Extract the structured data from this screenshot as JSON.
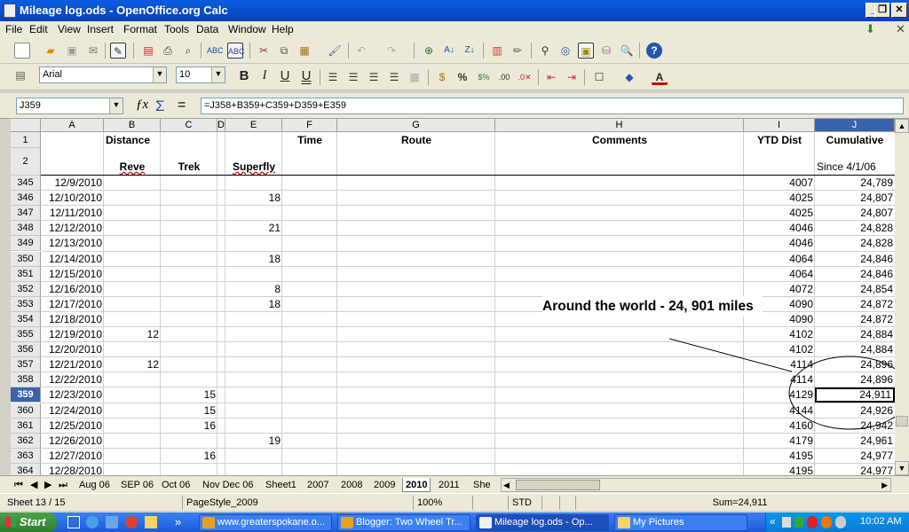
{
  "window": {
    "title": "Mileage log.ods - OpenOffice.org Calc"
  },
  "menu": [
    "File",
    "Edit",
    "View",
    "Insert",
    "Format",
    "Tools",
    "Data",
    "Window",
    "Help"
  ],
  "format_bar": {
    "font_name": "Arial",
    "font_size": "10",
    "bold": "B",
    "italic": "I",
    "underline": "U",
    "double_underline": "U"
  },
  "formula_bar": {
    "name_box": "J359",
    "formula": "=J358+B359+C359+D359+E359"
  },
  "columns": [
    "A",
    "B",
    "C",
    "D",
    "E",
    "F",
    "G",
    "H",
    "I",
    "J"
  ],
  "header_rows": {
    "row1": {
      "num": "1",
      "B": "Distance",
      "F": "Time",
      "G": "Route",
      "H": "Comments",
      "I": "YTD Dist",
      "J": "Cumulative"
    },
    "row2": {
      "num": "2",
      "B": "Reve",
      "C": "Trek",
      "E": "Superfly",
      "J": "Since 4/1/06"
    }
  },
  "rows": [
    {
      "num": "345",
      "date": "12/9/2010",
      "b": "",
      "c": "",
      "e": "",
      "ytd": "4007",
      "cum": "24,789"
    },
    {
      "num": "346",
      "date": "12/10/2010",
      "b": "",
      "c": "",
      "e": "18",
      "ytd": "4025",
      "cum": "24,807"
    },
    {
      "num": "347",
      "date": "12/11/2010",
      "b": "",
      "c": "",
      "e": "",
      "ytd": "4025",
      "cum": "24,807"
    },
    {
      "num": "348",
      "date": "12/12/2010",
      "b": "",
      "c": "",
      "e": "21",
      "ytd": "4046",
      "cum": "24,828"
    },
    {
      "num": "349",
      "date": "12/13/2010",
      "b": "",
      "c": "",
      "e": "",
      "ytd": "4046",
      "cum": "24,828"
    },
    {
      "num": "350",
      "date": "12/14/2010",
      "b": "",
      "c": "",
      "e": "18",
      "ytd": "4064",
      "cum": "24,846"
    },
    {
      "num": "351",
      "date": "12/15/2010",
      "b": "",
      "c": "",
      "e": "",
      "ytd": "4064",
      "cum": "24,846"
    },
    {
      "num": "352",
      "date": "12/16/2010",
      "b": "",
      "c": "",
      "e": "8",
      "ytd": "4072",
      "cum": "24,854"
    },
    {
      "num": "353",
      "date": "12/17/2010",
      "b": "",
      "c": "",
      "e": "18",
      "ytd": "4090",
      "cum": "24,872"
    },
    {
      "num": "354",
      "date": "12/18/2010",
      "b": "",
      "c": "",
      "e": "",
      "ytd": "4090",
      "cum": "24,872"
    },
    {
      "num": "355",
      "date": "12/19/2010",
      "b": "12",
      "c": "",
      "e": "",
      "ytd": "4102",
      "cum": "24,884"
    },
    {
      "num": "356",
      "date": "12/20/2010",
      "b": "",
      "c": "",
      "e": "",
      "ytd": "4102",
      "cum": "24,884"
    },
    {
      "num": "357",
      "date": "12/21/2010",
      "b": "12",
      "c": "",
      "e": "",
      "ytd": "4114",
      "cum": "24,896"
    },
    {
      "num": "358",
      "date": "12/22/2010",
      "b": "",
      "c": "",
      "e": "",
      "ytd": "4114",
      "cum": "24,896"
    },
    {
      "num": "359",
      "date": "12/23/2010",
      "b": "",
      "c": "15",
      "e": "",
      "ytd": "4129",
      "cum": "24,911",
      "active": true
    },
    {
      "num": "360",
      "date": "12/24/2010",
      "b": "",
      "c": "15",
      "e": "",
      "ytd": "4144",
      "cum": "24,926"
    },
    {
      "num": "361",
      "date": "12/25/2010",
      "b": "",
      "c": "16",
      "e": "",
      "ytd": "4160",
      "cum": "24,942"
    },
    {
      "num": "362",
      "date": "12/26/2010",
      "b": "",
      "c": "",
      "e": "19",
      "ytd": "4179",
      "cum": "24,961"
    },
    {
      "num": "363",
      "date": "12/27/2010",
      "b": "",
      "c": "16",
      "e": "",
      "ytd": "4195",
      "cum": "24,977"
    },
    {
      "num": "364",
      "date": "12/28/2010",
      "b": "",
      "c": "",
      "e": "",
      "ytd": "4195",
      "cum": "24,977"
    }
  ],
  "annotation": {
    "text": "Around the world - 24, 901 miles"
  },
  "sheet_tabs": [
    "Aug 06",
    "SEP 06",
    "Oct 06",
    "Nov Dec 06",
    "Sheet1",
    "2007",
    "2008",
    "2009",
    "2010",
    "2011",
    "She"
  ],
  "active_tab": "2010",
  "status": {
    "sheet": "Sheet 13 / 15",
    "page_style": "PageStyle_2009",
    "zoom": "100%",
    "mode": "STD",
    "sum": "Sum=24,911"
  },
  "taskbar": {
    "start": "Start",
    "overflow": "»",
    "tasks": [
      {
        "label": "www.greaterspokane.o...",
        "color": "#e8a020"
      },
      {
        "label": "Blogger: Two Wheel Tr...",
        "color": "#e8a020"
      },
      {
        "label": "Mileage log.ods - Op...",
        "color": "#f0f0f0",
        "active": true
      },
      {
        "label": "My Pictures",
        "color": "#f5d36a"
      }
    ],
    "clock": "10:02 AM"
  }
}
